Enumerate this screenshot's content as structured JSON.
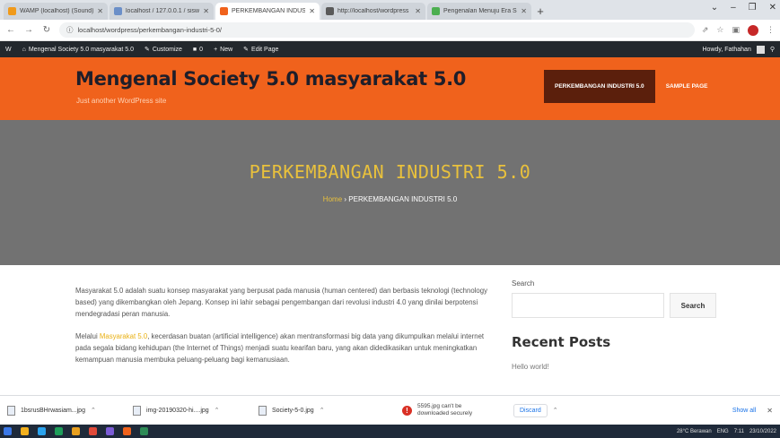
{
  "browser": {
    "tabs": [
      {
        "label": "WAMP (localhost) (Sound) ·",
        "active": false,
        "favicon_color": "#f09a1b"
      },
      {
        "label": "localhost / 127.0.0.1 / sisw",
        "active": false,
        "favicon_color": "#6b8fc8"
      },
      {
        "label": "PERKEMBANGAN INDUSTRI",
        "active": true,
        "favicon_color": "#f0621c"
      },
      {
        "label": "http://localhost/wordpress",
        "active": false,
        "favicon_color": "#5a5a5a"
      },
      {
        "label": "Pengenalan Menuju Era Societ",
        "active": false,
        "favicon_color": "#4caf50"
      }
    ],
    "new_tab": "+",
    "window_controls": [
      "⌄",
      "–",
      "❐",
      "✕"
    ],
    "url": "localhost/wordpress/perkembangan-industri-5-0/"
  },
  "adminbar": {
    "wp_logo": "W",
    "site_name": "Mengenal Society 5.0 masyarakat 5.0",
    "customize": "Customize",
    "comments": "0",
    "new": "New",
    "edit_page": "Edit Page",
    "howdy": "Howdy, Fathahan"
  },
  "site": {
    "title": "Mengenal Society 5.0 masyarakat 5.0",
    "tagline": "Just another WordPress site",
    "menu": [
      {
        "label": "PERKEMBANGAN INDUSTRI 5.0",
        "current": true
      },
      {
        "label": "SAMPLE PAGE",
        "current": false
      }
    ]
  },
  "hero": {
    "title": "PERKEMBANGAN INDUSTRI 5.0",
    "breadcrumb_home": "Home",
    "breadcrumb_sep": "›",
    "breadcrumb_current": "PERKEMBANGAN INDUSTRI 5.0"
  },
  "content": {
    "para1": "Masyarakat 5.0 adalah suatu konsep masyarakat yang berpusat pada manusia (human centered) dan berbasis teknologi (technology based) yang dikembangkan oleh Jepang. Konsep ini lahir sebagai pengembangan dari revolusi industri 4.0 yang dinilai berpotensi mendegradasi peran manusia.",
    "para2_before": "Melalui",
    "para2_link": "Masyarakat 5.0",
    "para2_after": ", kecerdasan buatan (artificial intelligence) akan mentransformasi big data yang dikumpulkan melalui internet pada segala bidang kehidupan (the Internet of Things) menjadi suatu kearifan baru, yang akan didedikasikan untuk meningkatkan kemampuan manusia membuka peluang-peluang bagi kemanusiaan."
  },
  "sidebar": {
    "search_label": "Search",
    "search_value": "",
    "search_button": "Search",
    "recent_title": "Recent Posts",
    "recent_posts": [
      "Hello world!"
    ]
  },
  "downloads": {
    "items": [
      {
        "name": "1bsrusBHrwasiam...jpg"
      },
      {
        "name": "img-20190320-hi....jpg"
      },
      {
        "name": "Society-5-0.jpg"
      }
    ],
    "failed_name": "5595.jpg can't be",
    "failed_note": "downloaded securely",
    "discard": "Discard",
    "show_all": "Show all",
    "close": "✕"
  },
  "taskbar": {
    "icon_colors": [
      "#3b78e7",
      "#f2b01e",
      "#2aa3ee",
      "#1e9e5a",
      "#e8a020",
      "#e04a3a",
      "#7b5cd6",
      "#f0621c",
      "#2e8b57"
    ],
    "weather": "28°C Berawan",
    "time": "7:11",
    "date": "23/10/2022",
    "lang": "ENG"
  }
}
